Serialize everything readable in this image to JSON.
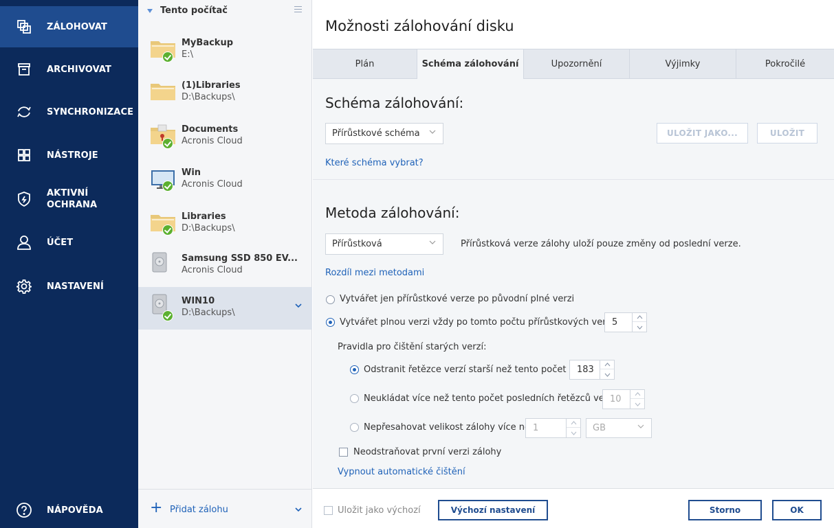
{
  "nav": {
    "items": [
      {
        "label": "ZÁLOHOVAT",
        "icon": "backup-icon"
      },
      {
        "label": "ARCHIVOVAT",
        "icon": "archive-icon"
      },
      {
        "label": "SYNCHRONIZACE",
        "icon": "sync-icon"
      },
      {
        "label": "NÁSTROJE",
        "icon": "tools-icon"
      },
      {
        "label": "AKTIVNÍ OCHRANA",
        "icon": "shield-icon"
      },
      {
        "label": "ÚČET",
        "icon": "user-icon"
      },
      {
        "label": "NASTAVENÍ",
        "icon": "gear-icon"
      }
    ],
    "help": {
      "label": "NÁPOVĚDA",
      "icon": "help-icon"
    }
  },
  "sources": {
    "title": "Tento počítač",
    "items": [
      {
        "name": "MyBackup",
        "dest": "E:\\"
      },
      {
        "name": "(1)Libraries",
        "dest": "D:\\Backups\\"
      },
      {
        "name": "Documents",
        "dest": "Acronis Cloud"
      },
      {
        "name": "Win",
        "dest": "Acronis Cloud"
      },
      {
        "name": "Libraries",
        "dest": "D:\\Backups\\"
      },
      {
        "name": "Samsung SSD 850 EV...",
        "dest": "Acronis Cloud"
      },
      {
        "name": "WIN10",
        "dest": "D:\\Backups\\"
      }
    ],
    "add_label": "Přidat zálohu"
  },
  "main": {
    "title": "Možnosti zálohování disku",
    "tabs": [
      "Plán",
      "Schéma zálohování",
      "Upozornění",
      "Výjimky",
      "Pokročilé"
    ],
    "scheme": {
      "heading": "Schéma zálohování:",
      "selected": "Přírůstkové schéma",
      "save_as": "ULOŽIT JAKO...",
      "save": "ULOŽIT",
      "help_link": "Které schéma vybrat?"
    },
    "method": {
      "heading": "Metoda zálohování:",
      "selected": "Přírůstková",
      "description": "Přírůstková verze zálohy uloží pouze změny od poslední verze.",
      "diff_link": "Rozdíl mezi metodami",
      "opt_incremental_only": "Vytvářet jen přírůstkové verze po původní plné verzi",
      "opt_full_after": "Vytvářet plnou verzi vždy po tomto počtu přírůstkových verzí:",
      "full_after_value": "5",
      "cleanup_title": "Pravidla pro čištění starých verzí:",
      "rule_days": "Odstranit řetězce verzí starší než tento počet dní:",
      "rule_days_value": "183",
      "rule_chains": "Neukládat více než tento počet posledních řetězců verzí:",
      "rule_chains_value": "10",
      "rule_size": "Nepřesahovat velikost zálohy více než",
      "rule_size_value": "1",
      "rule_size_unit": "GB",
      "keep_first": "Neodstraňovat první verzi zálohy",
      "disable_cleanup_link": "Vypnout automatické čištění"
    }
  },
  "footer": {
    "save_default": "Uložit jako výchozí",
    "defaults": "Výchozí nastavení",
    "cancel": "Storno",
    "ok": "OK"
  },
  "colors": {
    "nav_bg": "#0c2a5b",
    "nav_active": "#1f4c8f",
    "accent": "#1f62b8",
    "success": "#5cb030"
  }
}
